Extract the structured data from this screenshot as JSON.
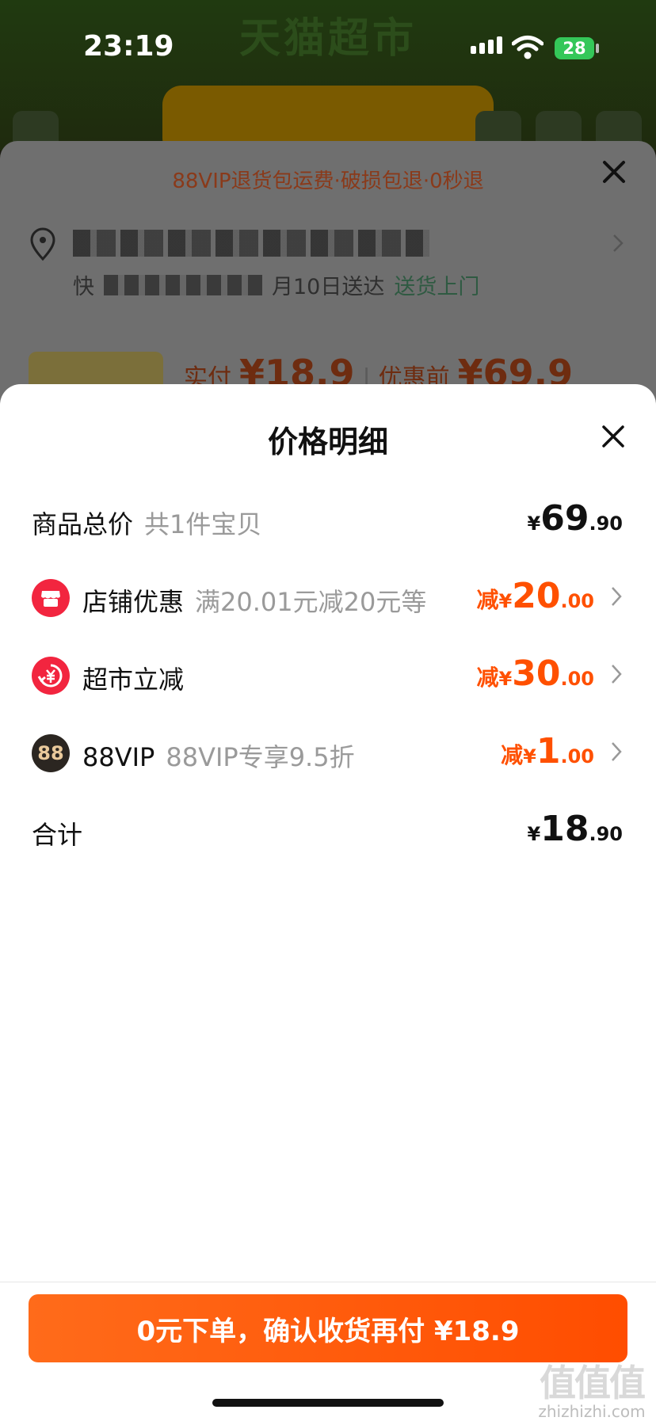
{
  "status_bar": {
    "time": "23:19",
    "battery": "28"
  },
  "background": {
    "header_title": "天猫超市"
  },
  "order_sheet": {
    "banner": "88VIP退货包运费·破损包退·0秒退",
    "delivery_text": "快",
    "delivery_suffix": "月10日送达",
    "delivery_service": "送货上门",
    "paid_label": "实付",
    "paid_amount": "¥18.9",
    "before_label": "优惠前",
    "before_amount": "¥69.9"
  },
  "detail": {
    "title": "价格明细",
    "rows": [
      {
        "label": "商品总价",
        "sub": "共1件宝贝",
        "prefix": "",
        "yen": "¥",
        "int": "69",
        "dec": ".90"
      },
      {
        "label": "店铺优惠",
        "sub": "满20.01元减20元等",
        "prefix": "减",
        "yen": "¥",
        "int": "20",
        "dec": ".00"
      },
      {
        "label": "超市立减",
        "sub": "",
        "prefix": "减",
        "yen": "¥",
        "int": "30",
        "dec": ".00"
      },
      {
        "label": "88VIP",
        "sub": "88VIP专享9.5折",
        "prefix": "减",
        "yen": "¥",
        "int": "1",
        "dec": ".00",
        "badge": "88"
      },
      {
        "label": "合计",
        "sub": "",
        "prefix": "",
        "yen": "¥",
        "int": "18",
        "dec": ".90"
      }
    ]
  },
  "cta": {
    "label": "0元下单，确认收货再付 ¥18.9"
  },
  "watermark": {
    "big": "值值值",
    "small": "zhizhizhi.com"
  },
  "colors": {
    "accent": "#ff5000",
    "store_icon": "#f2253f",
    "vip_badge": "#2b2621"
  }
}
